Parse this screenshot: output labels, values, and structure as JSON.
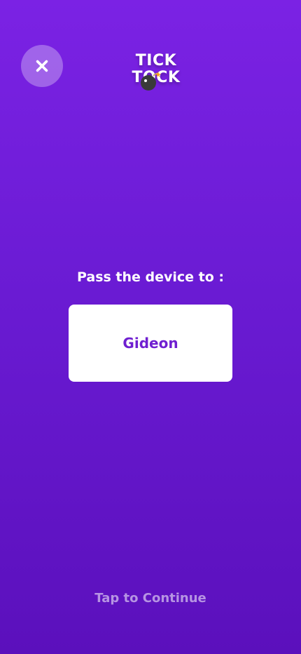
{
  "header": {
    "close_icon": "close-icon",
    "logo": {
      "line1": "TICK",
      "line2": "TOCK",
      "bomb_icon": "bomb-icon"
    }
  },
  "main": {
    "prompt": "Pass the device to :",
    "player_name": "Gideon"
  },
  "footer": {
    "continue_label": "Tap to Continue"
  },
  "colors": {
    "background_top": "#7b22e4",
    "background_bottom": "#5b10bc",
    "accent_text": "#6f1fd0",
    "card": "#ffffff"
  }
}
